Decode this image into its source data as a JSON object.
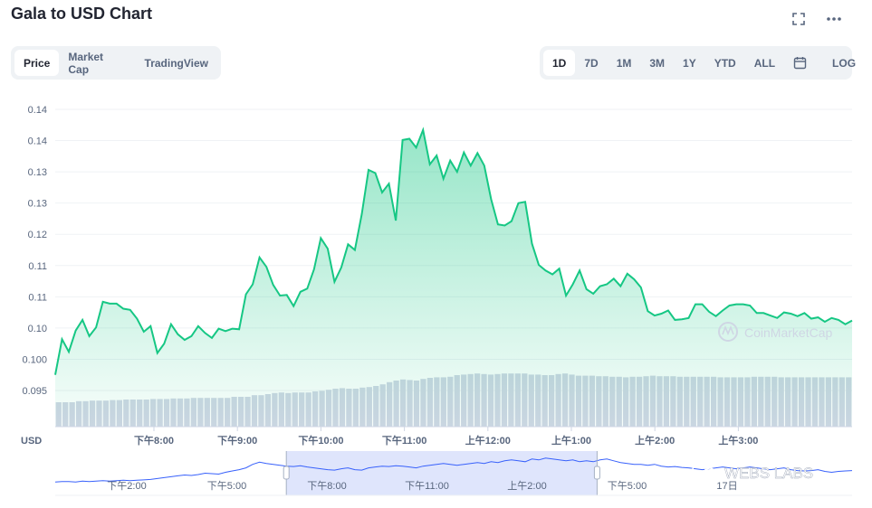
{
  "header": {
    "title": "Gala to USD Chart",
    "fullscreen_icon": "fullscreen-icon",
    "more_icon": "more-horizontal-icon"
  },
  "view_tabs": [
    {
      "label": "Price",
      "active": true
    },
    {
      "label": "Market Cap",
      "active": false
    },
    {
      "label": "TradingView",
      "active": false
    }
  ],
  "range_tabs": [
    {
      "label": "1D",
      "active": true
    },
    {
      "label": "7D",
      "active": false
    },
    {
      "label": "1M",
      "active": false
    },
    {
      "label": "3M",
      "active": false
    },
    {
      "label": "1Y",
      "active": false
    },
    {
      "label": "YTD",
      "active": false
    },
    {
      "label": "ALL",
      "active": false
    }
  ],
  "calendar_icon": "calendar-icon",
  "log_label": "LOG",
  "watermark": "CoinMarketCap",
  "corner_watermark": "WEBS LABS",
  "colors": {
    "line": "#16c784",
    "volume": "#cfd6e4",
    "navigator_line": "#3861fb",
    "navigator_window": "#dfe5fc"
  },
  "chart_data": {
    "type": "line",
    "currency_label": "USD",
    "y_ticks": [
      "0.14",
      "0.14",
      "0.13",
      "0.13",
      "0.12",
      "0.11",
      "0.11",
      "0.10",
      "0.100",
      "0.095"
    ],
    "ylim": [
      0.093,
      0.1415
    ],
    "x_ticks": [
      "下午8:00",
      "下午9:00",
      "下午10:00",
      "下午11:00",
      "上午12:00",
      "上午1:00",
      "上午2:00",
      "上午3:00"
    ],
    "grid": true,
    "series": [
      {
        "values": [
          0.0975,
          0.1032,
          0.1012,
          0.1046,
          0.1063,
          0.1037,
          0.1051,
          0.1092,
          0.1089,
          0.1089,
          0.1081,
          0.1079,
          0.1065,
          0.1044,
          0.1053,
          0.101,
          0.1025,
          0.1056,
          0.104,
          0.1031,
          0.1037,
          0.1053,
          0.1042,
          0.1034,
          0.1049,
          0.1045,
          0.1049,
          0.1048,
          0.1104,
          0.112,
          0.1163,
          0.1148,
          0.1119,
          0.1102,
          0.1103,
          0.1085,
          0.1108,
          0.1113,
          0.1144,
          0.1194,
          0.1177,
          0.1124,
          0.1147,
          0.1184,
          0.1175,
          0.1232,
          0.1303,
          0.1298,
          0.1267,
          0.1281,
          0.1222,
          0.1351,
          0.1353,
          0.1339,
          0.1367,
          0.1312,
          0.1326,
          0.1289,
          0.1318,
          0.13,
          0.1331,
          0.131,
          0.133,
          0.131,
          0.1256,
          0.1216,
          0.1214,
          0.1221,
          0.125,
          0.1252,
          0.1185,
          0.1151,
          0.1142,
          0.1136,
          0.1145,
          0.1102,
          0.112,
          0.1142,
          0.1112,
          0.1105,
          0.1117,
          0.112,
          0.1129,
          0.1117,
          0.1137,
          0.1128,
          0.1115,
          0.1077,
          0.107,
          0.1073,
          0.1078,
          0.1063,
          0.1064,
          0.1066,
          0.1088,
          0.1088,
          0.1076,
          0.1069,
          0.1078,
          0.1086,
          0.1088,
          0.1088,
          0.1086,
          0.1074,
          0.1074,
          0.107,
          0.1066,
          0.1075,
          0.1073,
          0.1069,
          0.1074,
          0.1065,
          0.1067,
          0.106,
          0.1066,
          0.1063,
          0.1056,
          0.1062
        ]
      }
    ],
    "volume_levels": [
      0.45,
      0.45,
      0.45,
      0.47,
      0.47,
      0.48,
      0.48,
      0.48,
      0.49,
      0.49,
      0.5,
      0.5,
      0.5,
      0.5,
      0.51,
      0.51,
      0.51,
      0.52,
      0.52,
      0.52,
      0.53,
      0.53,
      0.53,
      0.53,
      0.53,
      0.53,
      0.55,
      0.55,
      0.55,
      0.58,
      0.58,
      0.6,
      0.62,
      0.63,
      0.62,
      0.63,
      0.63,
      0.63,
      0.65,
      0.66,
      0.68,
      0.7,
      0.71,
      0.7,
      0.7,
      0.72,
      0.73,
      0.75,
      0.78,
      0.82,
      0.85,
      0.87,
      0.86,
      0.85,
      0.88,
      0.9,
      0.91,
      0.91,
      0.92,
      0.95,
      0.96,
      0.97,
      0.98,
      0.97,
      0.96,
      0.97,
      0.98,
      0.98,
      0.98,
      0.98,
      0.96,
      0.96,
      0.95,
      0.95,
      0.97,
      0.98,
      0.96,
      0.94,
      0.94,
      0.94,
      0.93,
      0.93,
      0.92,
      0.92,
      0.91,
      0.92,
      0.92,
      0.93,
      0.94,
      0.93,
      0.93,
      0.93,
      0.92,
      0.92,
      0.92,
      0.92,
      0.92,
      0.92,
      0.91,
      0.91,
      0.91,
      0.91,
      0.91,
      0.92,
      0.92,
      0.92,
      0.92,
      0.91,
      0.91,
      0.91,
      0.91,
      0.91,
      0.91,
      0.91,
      0.91,
      0.91,
      0.91,
      0.91
    ]
  },
  "navigator": {
    "x_ticks": [
      "下午2:00",
      "下午5:00",
      "下午8:00",
      "下午11:00",
      "上午2:00",
      "下午5:00",
      "17日"
    ],
    "window_start": 0.29,
    "window_end": 0.68,
    "values": [
      0.3,
      0.31,
      0.31,
      0.3,
      0.32,
      0.31,
      0.32,
      0.33,
      0.32,
      0.33,
      0.34,
      0.33,
      0.34,
      0.35,
      0.36,
      0.38,
      0.4,
      0.42,
      0.44,
      0.46,
      0.45,
      0.47,
      0.5,
      0.49,
      0.48,
      0.52,
      0.55,
      0.58,
      0.62,
      0.7,
      0.75,
      0.72,
      0.7,
      0.68,
      0.66,
      0.65,
      0.67,
      0.64,
      0.62,
      0.6,
      0.58,
      0.57,
      0.6,
      0.62,
      0.58,
      0.57,
      0.62,
      0.64,
      0.66,
      0.65,
      0.67,
      0.66,
      0.64,
      0.62,
      0.66,
      0.68,
      0.7,
      0.72,
      0.7,
      0.68,
      0.7,
      0.72,
      0.74,
      0.72,
      0.76,
      0.74,
      0.78,
      0.8,
      0.78,
      0.76,
      0.82,
      0.8,
      0.84,
      0.82,
      0.8,
      0.78,
      0.8,
      0.76,
      0.78,
      0.76,
      0.8,
      0.82,
      0.78,
      0.74,
      0.72,
      0.7,
      0.7,
      0.68,
      0.7,
      0.66,
      0.64,
      0.65,
      0.63,
      0.62,
      0.6,
      0.58,
      0.6,
      0.62,
      0.64,
      0.62,
      0.6,
      0.62,
      0.64,
      0.62,
      0.6,
      0.58,
      0.6,
      0.62,
      0.58,
      0.56,
      0.55,
      0.56,
      0.58,
      0.54,
      0.52,
      0.54,
      0.55,
      0.56
    ]
  }
}
